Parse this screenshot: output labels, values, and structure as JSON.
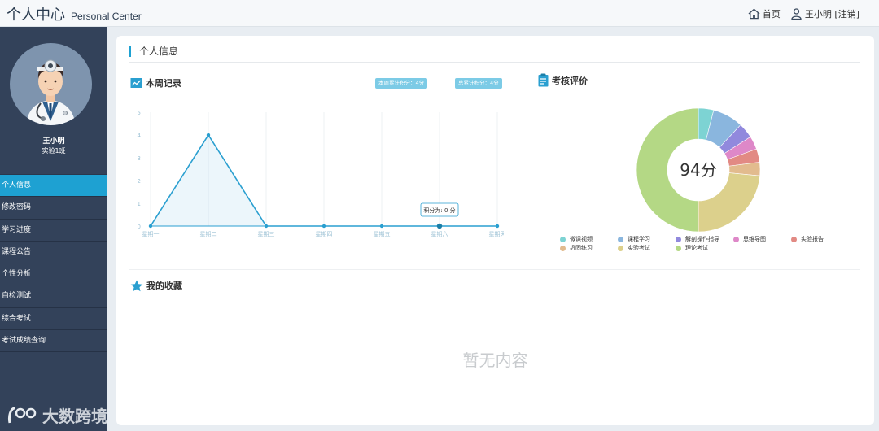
{
  "header": {
    "title_cn": "个人中心",
    "title_en": "Personal Center",
    "home_label": "首页",
    "user_label": "王小明 [注销]"
  },
  "profile": {
    "name": "王小明",
    "class": "实验1班"
  },
  "sidebar": {
    "items": [
      {
        "label": "个人信息",
        "active": true
      },
      {
        "label": "修改密码",
        "active": false
      },
      {
        "label": "学习进度",
        "active": false
      },
      {
        "label": "课程公告",
        "active": false
      },
      {
        "label": "个性分析",
        "active": false
      },
      {
        "label": "自检测试",
        "active": false
      },
      {
        "label": "综合考试",
        "active": false
      },
      {
        "label": "考试成绩查询",
        "active": false
      }
    ]
  },
  "watermark": "大数跨境",
  "main": {
    "section_title": "个人信息",
    "weekly": {
      "title": "本周记录",
      "week_total": "本周累计积分：4分",
      "all_total": "总累计积分：4分",
      "tooltip": "积分为: 0 分"
    },
    "assessment": {
      "title": "考核评价",
      "center_label": "94分"
    },
    "favorites": {
      "title": "我的收藏",
      "empty_text": "暂无内容"
    }
  },
  "chart_data": [
    {
      "type": "line",
      "categories": [
        "星期一",
        "星期二",
        "星期三",
        "星期四",
        "星期五",
        "星期六",
        "星期天"
      ],
      "values": [
        0,
        4,
        0,
        0,
        0,
        0,
        0
      ],
      "ylim": [
        0,
        5
      ],
      "yticks": [
        0,
        1,
        2,
        3,
        4,
        5
      ],
      "area_fill": true,
      "line_color": "#2a9fd0",
      "highlighted_index": 5
    },
    {
      "type": "pie",
      "donut": true,
      "center_label": "94分",
      "slices": [
        {
          "label": "微课视频",
          "value": 4,
          "color": "#7dd3d3"
        },
        {
          "label": "课程学习",
          "value": 8,
          "color": "#8ab6de"
        },
        {
          "label": "解剖操作指导",
          "value": 4,
          "color": "#9189dd"
        },
        {
          "label": "思维导图",
          "value": 3.5,
          "color": "#de88c8"
        },
        {
          "label": "实验报告",
          "value": 3.5,
          "color": "#e28a84"
        },
        {
          "label": "巩固练习",
          "value": 3.5,
          "color": "#e2bb8e"
        },
        {
          "label": "实验考试",
          "value": 23.5,
          "color": "#dcd08c"
        },
        {
          "label": "理论考试",
          "value": 50,
          "color": "#b4d885"
        }
      ]
    }
  ]
}
